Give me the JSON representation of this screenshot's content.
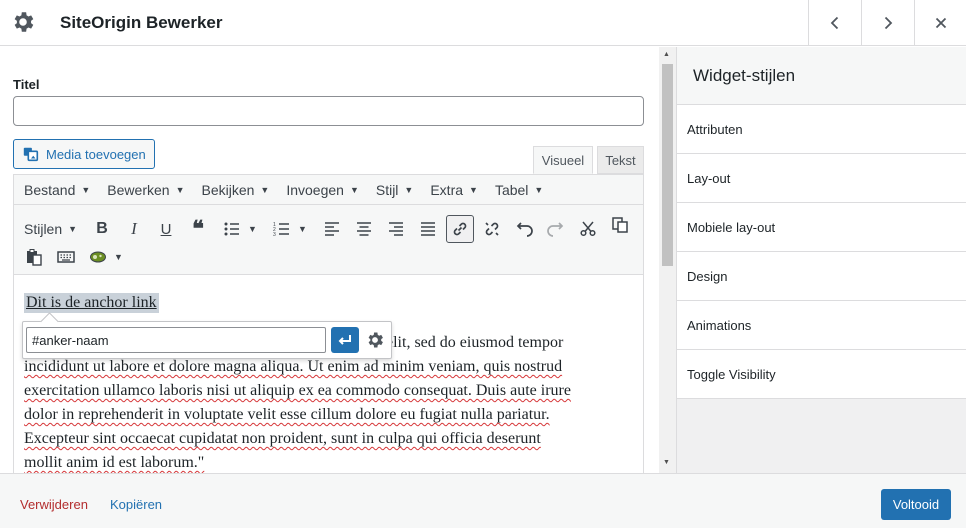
{
  "header": {
    "title": "SiteOrigin Bewerker"
  },
  "form": {
    "title_label": "Titel",
    "title_value": ""
  },
  "media_button_label": "Media toevoegen",
  "tabs": {
    "visual": "Visueel",
    "text": "Tekst"
  },
  "menubar": [
    "Bestand",
    "Bewerken",
    "Bekijken",
    "Invoegen",
    "Stijl",
    "Extra",
    "Tabel"
  ],
  "toolbar": {
    "styles_label": "Stijlen"
  },
  "content": {
    "anchor_text": "Dit is de anchor link",
    "paragraph_lines": [
      "elit, sed do eiusmod tempor",
      "incididunt ut labore et dolore magna aliqua. Ut enim ad minim veniam, quis nostrud",
      "exercitation ullamco laboris nisi ut aliquip ex ea commodo consequat. Duis aute irure",
      "dolor in reprehenderit in voluptate velit esse cillum dolore eu fugiat nulla pariatur.",
      "Excepteur sint occaecat cupidatat non proident, sunt in culpa qui officia deserunt",
      "mollit anim id est laborum.\""
    ]
  },
  "link_popup": {
    "value": "#anker-naam"
  },
  "sidebar": {
    "title": "Widget-stijlen",
    "sections": [
      "Attributen",
      "Lay-out",
      "Mobiele lay-out",
      "Design",
      "Animations",
      "Toggle Visibility"
    ]
  },
  "footer": {
    "delete_label": "Verwijderen",
    "copy_label": "Kopiëren",
    "done_label": "Voltooid"
  },
  "colors": {
    "accent": "#2271b1",
    "danger": "#b32d2e",
    "border": "#dcdcde"
  }
}
